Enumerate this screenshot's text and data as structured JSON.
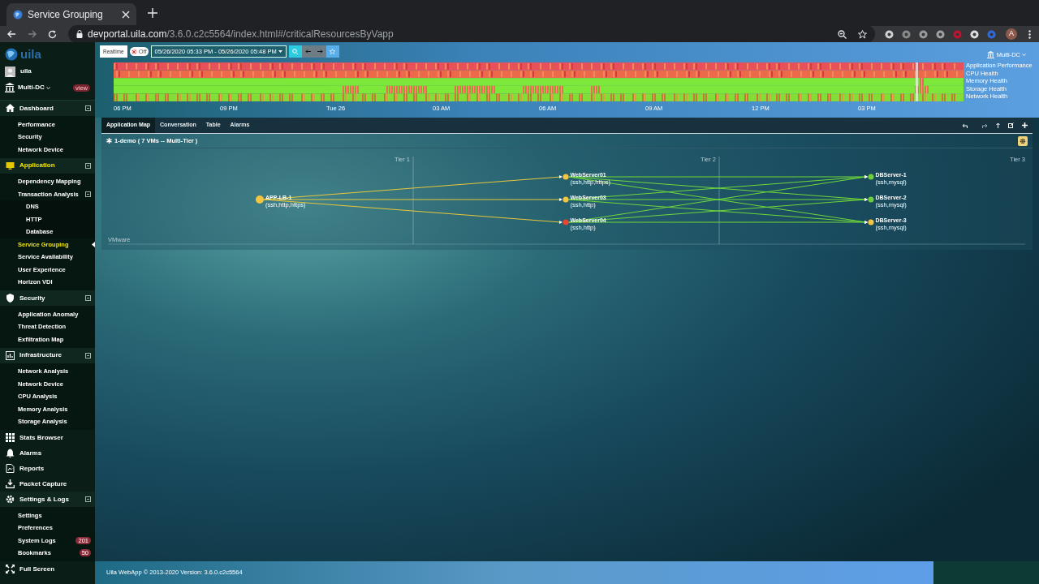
{
  "browser": {
    "tab_title": "Service Grouping",
    "url_host": "devportal.uila.com",
    "url_path": "/3.6.0.c2c5564/index.html#/criticalResourcesByVapp",
    "profile_initial": "A"
  },
  "sidebar": {
    "logo": "uila",
    "user": "uila",
    "datacenter": "Multi-DC",
    "datacenter_badge": "view",
    "items": [
      {
        "label": "Dashboard",
        "selected": false,
        "expanded": true,
        "children": [
          {
            "label": "Performance",
            "selected": false
          },
          {
            "label": "Security",
            "selected": false
          },
          {
            "label": "Network Device",
            "selected": false
          }
        ]
      },
      {
        "label": "Application",
        "selected": true,
        "expanded": true,
        "children": [
          {
            "label": "Dependency Mapping",
            "selected": false
          },
          {
            "label": "Transaction Analysis",
            "selected": false,
            "expanded": true,
            "children": [
              {
                "label": "DNS",
                "selected": false
              },
              {
                "label": "HTTP",
                "selected": false
              },
              {
                "label": "Database",
                "selected": false
              }
            ]
          },
          {
            "label": "Service Grouping",
            "selected": true
          },
          {
            "label": "Service Availability",
            "selected": false
          },
          {
            "label": "User Experience",
            "selected": false
          },
          {
            "label": "Horizon VDI",
            "selected": false
          }
        ]
      },
      {
        "label": "Security",
        "selected": false,
        "expanded": true,
        "children": [
          {
            "label": "Application Anomaly",
            "selected": false
          },
          {
            "label": "Threat Detection",
            "selected": false
          },
          {
            "label": "Exfiltration Map",
            "selected": false
          }
        ]
      },
      {
        "label": "Infrastructure",
        "selected": false,
        "expanded": true,
        "children": [
          {
            "label": "Network Analysis",
            "selected": false
          },
          {
            "label": "Network Device",
            "selected": false
          },
          {
            "label": "CPU Analysis",
            "selected": false
          },
          {
            "label": "Memory Analysis",
            "selected": false
          },
          {
            "label": "Storage Analysis",
            "selected": false
          }
        ]
      },
      {
        "label": "Stats Browser",
        "selected": false
      },
      {
        "label": "Alarms",
        "selected": false
      },
      {
        "label": "Reports",
        "selected": false
      },
      {
        "label": "Packet Capture",
        "selected": false
      },
      {
        "label": "Settings & Logs",
        "selected": false,
        "expanded": true,
        "children": [
          {
            "label": "Settings",
            "selected": false
          },
          {
            "label": "Preferences",
            "selected": false
          },
          {
            "label": "System Logs",
            "selected": false,
            "badge": "201"
          },
          {
            "label": "Bookmarks",
            "selected": false,
            "badge": "50"
          }
        ]
      },
      {
        "label": "Full Screen",
        "selected": false
      }
    ]
  },
  "toolbar": {
    "realtime": "Realtime",
    "realtime_on": false,
    "toggle_label": "Off",
    "range": "05/26/2020 05:33 PM - 05/26/2020 05:48 PM",
    "datacenter": "Multi-DC"
  },
  "timeline": {
    "row_labels": [
      "Application Performance",
      "CPU Health",
      "Memory Health",
      "Storage Health",
      "Network Health"
    ],
    "ticks": [
      "06 PM",
      "09 PM",
      "Tue 26",
      "03 AM",
      "06 AM",
      "09 AM",
      "12 PM",
      "03 PM"
    ]
  },
  "tabs": [
    {
      "label": "Application Map",
      "selected": true
    },
    {
      "label": "Conversation",
      "selected": false
    },
    {
      "label": "Table",
      "selected": false
    },
    {
      "label": "Alarms",
      "selected": false
    }
  ],
  "group": {
    "title": "1-demo ( 7 VMs -- Multi-Tier )",
    "platform": "VMware",
    "tiers": [
      {
        "label": "Tier 1",
        "nodes": [
          {
            "name": "APP-LB-1",
            "services": "(ssh,http,https)",
            "color": "#f5c542"
          }
        ]
      },
      {
        "label": "Tier 2",
        "nodes": [
          {
            "name": "WebServer01",
            "services": "(ssh,http,https)",
            "color": "#f5c542"
          },
          {
            "name": "WebServer03",
            "services": "(ssh,http)",
            "color": "#f5c542"
          },
          {
            "name": "WebServer04",
            "services": "(ssh,http)",
            "color": "#e8442e"
          }
        ]
      },
      {
        "label": "Tier 3",
        "nodes": [
          {
            "name": "DBServer-1",
            "services": "(ssh,mysql)",
            "color": "#6ccf3a"
          },
          {
            "name": "DBServer-2",
            "services": "(ssh,mysql)",
            "color": "#6ccf3a"
          },
          {
            "name": "DBServer-3",
            "services": "(ssh,mysql)",
            "color": "#f5c542"
          }
        ]
      }
    ]
  },
  "footer": "Uila WebApp © 2013-2020 Version: 3.6.0.c2c5564"
}
